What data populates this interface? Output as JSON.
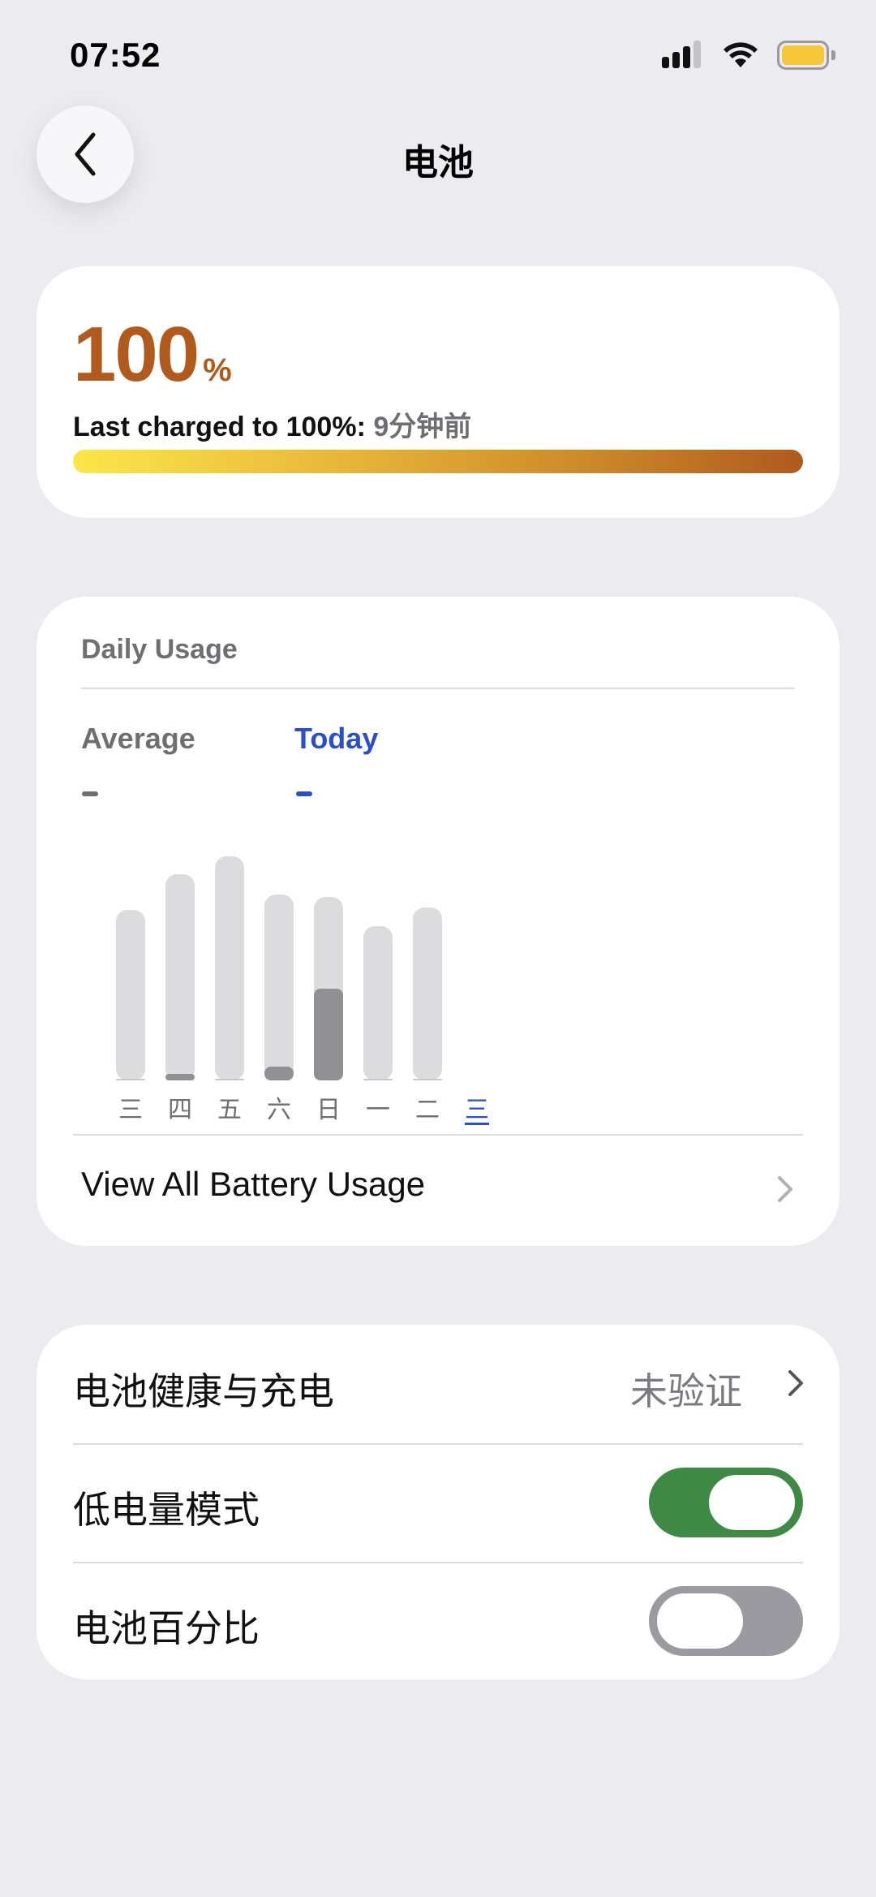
{
  "status_bar": {
    "time": "07:52",
    "icons": [
      "cellular-signal-icon",
      "wifi-icon",
      "battery-icon"
    ],
    "battery_color": "#f6c738"
  },
  "nav": {
    "back_icon": "chevron-left-icon",
    "title": "电池"
  },
  "battery_card": {
    "percent": "100",
    "percent_sign": "%",
    "last_charged_label": "Last charged to 100%:",
    "last_charged_value": "9分钟前",
    "accent_color": "#b05a1e",
    "charge_level": 1.0
  },
  "usage_card": {
    "title": "Daily Usage",
    "average_label": "Average",
    "average_value": "–",
    "today_label": "Today",
    "today_value": "–",
    "today_color": "#2a4fc7",
    "view_all_label": "View All Battery Usage",
    "chart_data": {
      "type": "bar",
      "categories": [
        "三",
        "四",
        "五",
        "六",
        "日",
        "一",
        "二",
        "三"
      ],
      "series": [
        {
          "values": [
            0.76,
            0.92,
            1.0,
            0.83,
            0.82,
            0.69,
            0.77,
            0
          ]
        },
        {
          "values": [
            0.0,
            0.03,
            0.0,
            0.06,
            0.41,
            0.0,
            0.0,
            0
          ]
        }
      ],
      "highlight_category_index": 7
    }
  },
  "settings_card": {
    "battery_health": {
      "label": "电池健康与充电",
      "value": "未验证"
    },
    "low_power_mode": {
      "label": "低电量模式",
      "on": true,
      "color": "#3e8a44"
    },
    "battery_percentage": {
      "label": "电池百分比",
      "on": false,
      "color": "#9a9aa0"
    }
  }
}
